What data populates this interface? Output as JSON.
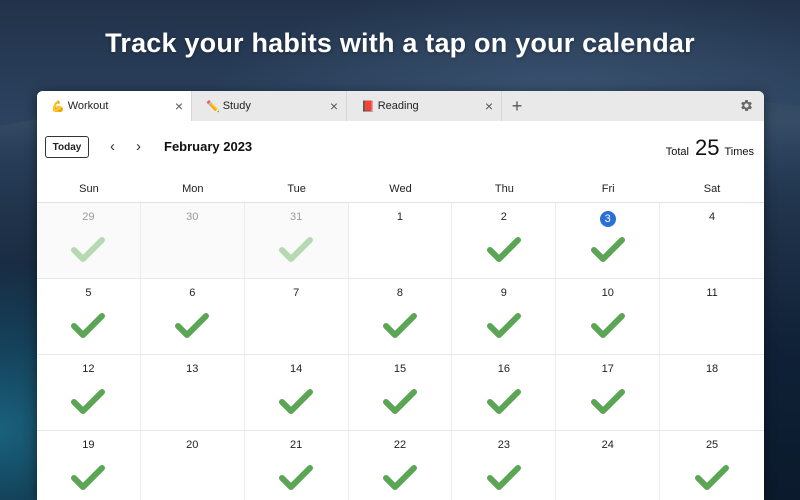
{
  "headline": "Track your habits with a tap on your calendar",
  "tabs": [
    {
      "emoji": "💪",
      "label": "Workout",
      "active": true
    },
    {
      "emoji": "✏️",
      "label": "Study",
      "active": false
    },
    {
      "emoji": "📕",
      "label": "Reading",
      "active": false
    }
  ],
  "new_tab_label": "+",
  "close_glyph": "×",
  "toolbar": {
    "today_label": "Today",
    "prev_glyph": "‹",
    "next_glyph": "›",
    "month_label": "February 2023",
    "total_label": "Total",
    "total_count": "25",
    "times_label": "Times"
  },
  "weekdays": [
    "Sun",
    "Mon",
    "Tue",
    "Wed",
    "Thu",
    "Fri",
    "Sat"
  ],
  "colors": {
    "check": "#5aa654",
    "check_faded": "#b5d9b2",
    "today_circle": "#2a6fd8"
  },
  "weeks": [
    [
      {
        "day": "29",
        "other": true,
        "checked": true
      },
      {
        "day": "30",
        "other": true,
        "checked": false
      },
      {
        "day": "31",
        "other": true,
        "checked": true
      },
      {
        "day": "1",
        "other": false,
        "checked": false
      },
      {
        "day": "2",
        "other": false,
        "checked": true
      },
      {
        "day": "3",
        "other": false,
        "checked": true,
        "today": true
      },
      {
        "day": "4",
        "other": false,
        "checked": false
      }
    ],
    [
      {
        "day": "5",
        "other": false,
        "checked": true
      },
      {
        "day": "6",
        "other": false,
        "checked": true
      },
      {
        "day": "7",
        "other": false,
        "checked": false
      },
      {
        "day": "8",
        "other": false,
        "checked": true
      },
      {
        "day": "9",
        "other": false,
        "checked": true
      },
      {
        "day": "10",
        "other": false,
        "checked": true
      },
      {
        "day": "11",
        "other": false,
        "checked": false
      }
    ],
    [
      {
        "day": "12",
        "other": false,
        "checked": true
      },
      {
        "day": "13",
        "other": false,
        "checked": false
      },
      {
        "day": "14",
        "other": false,
        "checked": true
      },
      {
        "day": "15",
        "other": false,
        "checked": true
      },
      {
        "day": "16",
        "other": false,
        "checked": true
      },
      {
        "day": "17",
        "other": false,
        "checked": true
      },
      {
        "day": "18",
        "other": false,
        "checked": false
      }
    ],
    [
      {
        "day": "19",
        "other": false,
        "checked": true
      },
      {
        "day": "20",
        "other": false,
        "checked": false
      },
      {
        "day": "21",
        "other": false,
        "checked": true
      },
      {
        "day": "22",
        "other": false,
        "checked": true
      },
      {
        "day": "23",
        "other": false,
        "checked": true
      },
      {
        "day": "24",
        "other": false,
        "checked": false
      },
      {
        "day": "25",
        "other": false,
        "checked": true
      }
    ]
  ]
}
